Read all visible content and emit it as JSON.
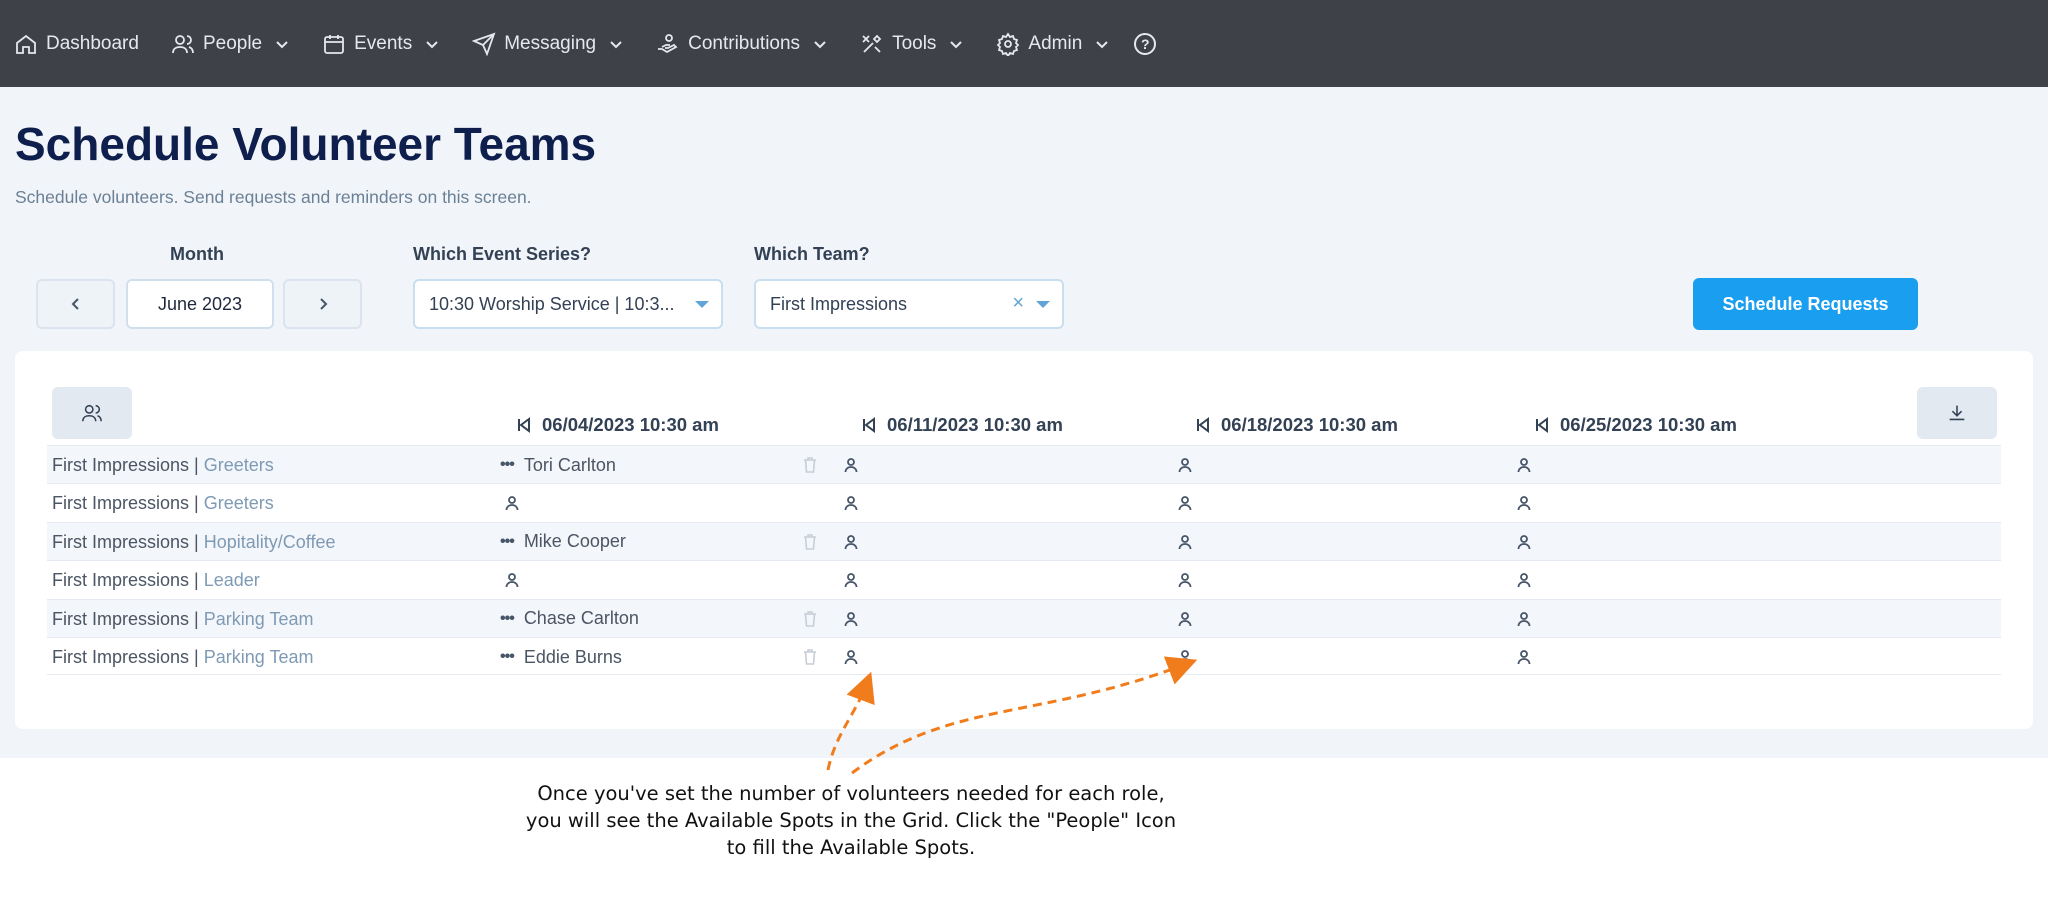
{
  "nav": {
    "items": [
      {
        "label": "Dashboard",
        "icon": "home-icon",
        "chevron": false
      },
      {
        "label": "People",
        "icon": "people-icon",
        "chevron": true
      },
      {
        "label": "Events",
        "icon": "calendar-icon",
        "chevron": true
      },
      {
        "label": "Messaging",
        "icon": "send-icon",
        "chevron": true
      },
      {
        "label": "Contributions",
        "icon": "hand-coins-icon",
        "chevron": true
      },
      {
        "label": "Tools",
        "icon": "tools-icon",
        "chevron": true
      },
      {
        "label": "Admin",
        "icon": "gear-icon",
        "chevron": true
      }
    ],
    "help_label": "?"
  },
  "page": {
    "title": "Schedule Volunteer Teams",
    "subtitle": "Schedule volunteers. Send requests and reminders on this screen."
  },
  "filters": {
    "month_label": "Month",
    "month_value": "June 2023",
    "event_series_label": "Which Event Series?",
    "event_series_value": "10:30 Worship Service | 10:3...",
    "team_label": "Which Team?",
    "team_value": "First Impressions",
    "schedule_button": "Schedule Requests"
  },
  "grid": {
    "columns": [
      "06/04/2023 10:30 am",
      "06/11/2023 10:30 am",
      "06/18/2023 10:30 am",
      "06/25/2023 10:30 am"
    ],
    "rows": [
      {
        "team": "First Impressions",
        "separator": "|",
        "role": "Greeters",
        "cells": [
          "Tori Carlton",
          "",
          "",
          ""
        ]
      },
      {
        "team": "First Impressions",
        "separator": "|",
        "role": "Greeters",
        "cells": [
          "",
          "",
          "",
          ""
        ]
      },
      {
        "team": "First Impressions",
        "separator": "|",
        "role": "Hopitality/Coffee",
        "cells": [
          "Mike Cooper",
          "",
          "",
          ""
        ]
      },
      {
        "team": "First Impressions",
        "separator": "|",
        "role": "Leader",
        "cells": [
          "",
          "",
          "",
          ""
        ]
      },
      {
        "team": "First Impressions",
        "separator": "|",
        "role": "Parking Team",
        "cells": [
          "Chase Carlton",
          "",
          "",
          ""
        ]
      },
      {
        "team": "First Impressions",
        "separator": "|",
        "role": "Parking Team",
        "cells": [
          "Eddie Burns",
          "",
          "",
          ""
        ]
      }
    ],
    "dots_glyph": "•••"
  },
  "annotation": {
    "line1": "Once you've set the number of volunteers needed for each role,",
    "line2": "you will see the Available Spots in the Grid.  Click the \"People\" Icon",
    "line3": "to fill the Available Spots.",
    "arrow_color": "#f07c1b"
  },
  "colors": {
    "nav_bg": "#3f4149",
    "primary": "#1a9ef0",
    "title": "#0f1f4d",
    "role_link": "#7f9ab4"
  }
}
